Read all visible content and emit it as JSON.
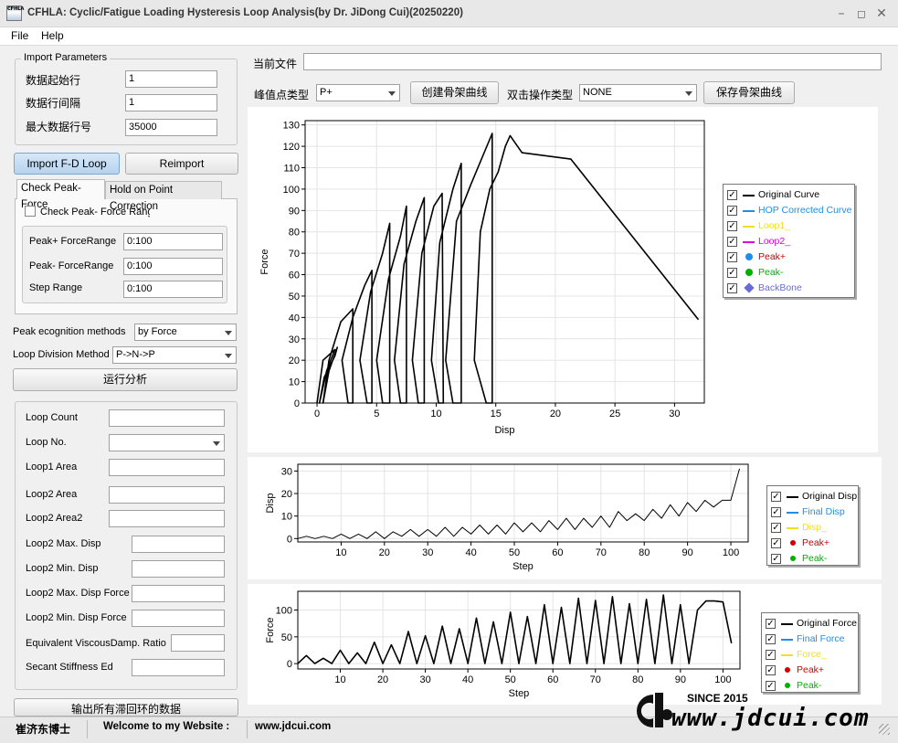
{
  "window": {
    "title": "CFHLA: Cyclic/Fatigue Loading Hysteresis Loop Analysis(by Dr. JiDong Cui)(20250220)",
    "icon_text": "CFHLA"
  },
  "menu": {
    "file": "File",
    "help": "Help"
  },
  "import_params": {
    "title": "Import Parameters",
    "start_row_label": "数据起始行",
    "start_row": "1",
    "row_interval_label": "数据行间隔",
    "row_interval": "1",
    "max_row_label": "最大数据行号",
    "max_row": "35000"
  },
  "buttons": {
    "import": "Import F-D Loop",
    "reimport": "Reimport",
    "run": "运行分析",
    "export": "输出所有滞回环的数据",
    "create_backbone": "创建骨架曲线",
    "save_backbone": "保存骨架曲线"
  },
  "tabs": {
    "check": "Check Peak-Force",
    "hold": "Hold on Point Correction"
  },
  "check": {
    "checkbox_label": "Check Peak- Force Range",
    "peak_plus_label": "Peak+ ForceRange",
    "peak_plus": "0:100",
    "peak_minus_label": "Peak- ForceRange",
    "peak_minus": "0:100",
    "step_label": "Step Range",
    "step": "0:100"
  },
  "methods": {
    "peak_label": "Peak ecognition methods",
    "peak_value": "by Force",
    "loop_label": "Loop Division Method",
    "loop_value": "P->N->P"
  },
  "results": {
    "loop_count": "Loop Count",
    "loop_no": "Loop No.",
    "loop1_area": "Loop1 Area",
    "loop2_area": "Loop2 Area",
    "loop2_area2": "Loop2 Area2",
    "loop2_max_disp": "Loop2 Max. Disp",
    "loop2_min_disp": "Loop2 Min. Disp",
    "loop2_max_force": "Loop2 Max. Disp Force",
    "loop2_min_force": "Loop2 Min. Disp Force",
    "viscous": "Equivalent ViscousDamp. Ratio",
    "secant": "Secant Stiffness Ed"
  },
  "top": {
    "current_file_label": "当前文件",
    "current_file": "",
    "peak_type_label": "峰值点类型",
    "peak_type": "P+",
    "dblclick_label": "双击操作类型",
    "dblclick": "NONE"
  },
  "colors": {
    "black": "#000000",
    "blue": "#1e8ee8",
    "yellow": "#f0e020",
    "magenta": "#e000e0",
    "red": "#d00000",
    "green": "#00b000",
    "backbone": "#6b6bd8"
  },
  "chart_data": [
    {
      "type": "line",
      "xlabel": "Disp",
      "ylabel": "Force",
      "xlim": [
        -1,
        32.5
      ],
      "ylim": [
        0,
        132
      ],
      "xticks": [
        0,
        5,
        10,
        15,
        20,
        25,
        30
      ],
      "yticks": [
        0,
        10,
        20,
        30,
        40,
        50,
        60,
        70,
        80,
        90,
        100,
        110,
        120,
        130
      ],
      "legend": [
        "Original Curve",
        "HOP Corrected Curve",
        "Loop1_",
        "Loop2_",
        "Peak+",
        "Peak-",
        "BackBone"
      ],
      "series": [
        {
          "name": "Original Curve",
          "x": [
            0,
            0.5,
            1.5,
            0.8,
            0.2,
            0.6,
            1.5,
            1.7,
            1.0,
            0.5,
            1.0,
            2.0,
            3.0,
            3.0,
            2.6,
            2.1,
            3.0,
            4.0,
            4.6,
            4.6,
            4.2,
            3.6,
            4.5,
            5.5,
            6.1,
            6.1,
            5.5,
            5.0,
            6.0,
            7.0,
            7.5,
            7.5,
            7.0,
            6.5,
            7.3,
            8.3,
            9.0,
            9.0,
            8.5,
            8.0,
            8.8,
            9.8,
            10.5,
            10.6,
            10.2,
            9.6,
            10.3,
            11.4,
            12.1,
            12.1,
            11.4,
            10.8,
            11.7,
            12.9,
            14.7,
            14.7,
            14.2,
            13.2,
            13.7,
            14.5,
            15.2,
            15.8,
            16.2,
            17.2,
            21.3,
            32.0
          ],
          "y": [
            0,
            20,
            25,
            15,
            0,
            12,
            22,
            26,
            15,
            0,
            20,
            38,
            44,
            0,
            0,
            20,
            40,
            55,
            62,
            0,
            0,
            20,
            52,
            70,
            84,
            0,
            0,
            20,
            58,
            78,
            92,
            0,
            0,
            20,
            65,
            85,
            96,
            0,
            0,
            20,
            70,
            92,
            98,
            0,
            0,
            20,
            75,
            100,
            112,
            0,
            0,
            20,
            85,
            102,
            126,
            0,
            0,
            20,
            80,
            100,
            108,
            120,
            125,
            117,
            114,
            39
          ]
        }
      ]
    },
    {
      "type": "line",
      "xlabel": "Step",
      "ylabel": "Disp",
      "xlim": [
        0,
        104
      ],
      "ylim": [
        -1.5,
        33
      ],
      "xticks": [
        10,
        20,
        30,
        40,
        50,
        60,
        70,
        80,
        90,
        100
      ],
      "yticks": [
        0,
        10,
        20,
        30
      ],
      "legend": [
        "Original Disp",
        "Final Disp",
        "Disp_",
        "Peak+",
        "Peak-"
      ],
      "series": [
        {
          "name": "Original Disp",
          "x": [
            0,
            2,
            4,
            6,
            8,
            10,
            12,
            14,
            16,
            18,
            20,
            22,
            24,
            26,
            28,
            30,
            32,
            34,
            36,
            38,
            40,
            42,
            44,
            46,
            48,
            50,
            52,
            54,
            56,
            58,
            60,
            62,
            64,
            66,
            68,
            70,
            72,
            74,
            76,
            78,
            80,
            82,
            84,
            86,
            88,
            90,
            92,
            94,
            96,
            98,
            100,
            102
          ],
          "y": [
            0,
            1,
            0,
            1,
            0,
            2,
            0,
            2,
            0,
            3,
            0,
            3,
            1,
            4,
            1,
            4,
            1,
            5,
            1,
            5,
            2,
            6,
            2,
            6,
            2,
            7,
            3,
            7,
            3,
            8,
            4,
            9,
            4,
            9,
            5,
            10,
            5,
            12,
            8,
            11,
            8,
            13,
            9,
            15,
            10,
            16,
            12,
            17,
            14,
            17,
            17,
            31
          ]
        }
      ]
    },
    {
      "type": "line",
      "xlabel": "Step",
      "ylabel": "Force",
      "xlim": [
        0,
        104
      ],
      "ylim": [
        -10,
        135
      ],
      "xticks": [
        10,
        20,
        30,
        40,
        50,
        60,
        70,
        80,
        90,
        100
      ],
      "yticks": [
        0,
        50,
        100
      ],
      "legend": [
        "Original Force",
        "Final Force",
        "Force_",
        "Peak+",
        "Peak-"
      ],
      "series": [
        {
          "name": "Original Force",
          "x": [
            0,
            2,
            4,
            6,
            8,
            10,
            12,
            14,
            16,
            18,
            20,
            22,
            24,
            26,
            28,
            30,
            32,
            34,
            36,
            38,
            40,
            42,
            44,
            46,
            48,
            50,
            52,
            54,
            56,
            58,
            60,
            62,
            64,
            66,
            68,
            70,
            72,
            74,
            76,
            78,
            80,
            82,
            84,
            86,
            88,
            90,
            92,
            94,
            96,
            98,
            100,
            102
          ],
          "y": [
            0,
            15,
            0,
            10,
            0,
            25,
            0,
            20,
            0,
            40,
            0,
            35,
            0,
            60,
            0,
            52,
            0,
            70,
            0,
            65,
            0,
            85,
            0,
            78,
            0,
            96,
            0,
            88,
            0,
            110,
            0,
            105,
            0,
            122,
            0,
            118,
            0,
            125,
            0,
            112,
            0,
            120,
            0,
            128,
            0,
            110,
            0,
            100,
            117,
            117,
            115,
            38
          ]
        }
      ]
    }
  ],
  "status": {
    "author": "崔济东博士",
    "welcome": "Welcome to my Website :",
    "url": "www.jdcui.com"
  },
  "watermark": {
    "since": "SINCE 2015",
    "url": "www.jdcui.com"
  }
}
